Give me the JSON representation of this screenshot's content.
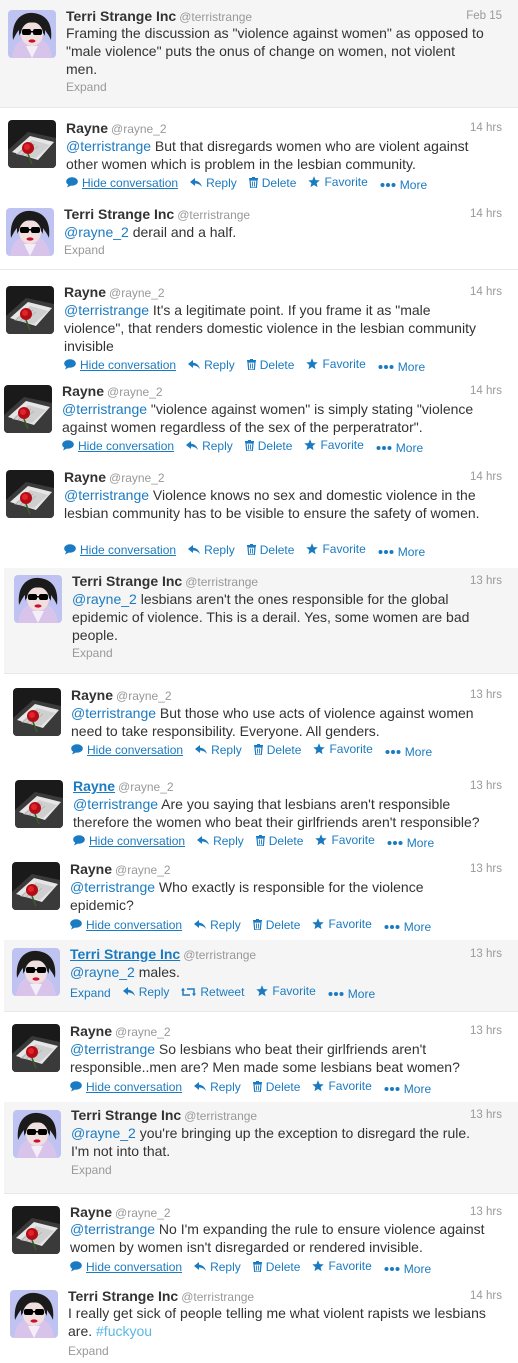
{
  "icons": {
    "reply": "reply-arrow-icon",
    "delete": "trash-icon",
    "favorite": "star-icon",
    "more": "dots-icon",
    "retweet": "retweet-icon",
    "hide": "speech-bubble-icon"
  },
  "colors": {
    "link": "#1b7bc2",
    "hashtag": "#5bb8e6",
    "meta": "#999999",
    "text": "#333333",
    "highlight_bg": "#f5f5f5"
  },
  "labels": {
    "hide_conversation": "Hide conversation",
    "reply": "Reply",
    "delete": "Delete",
    "favorite": "Favorite",
    "more": "More",
    "retweet": "Retweet",
    "expand": "Expand"
  },
  "tweets": [
    {
      "author": "Terri Strange Inc",
      "handle": "@terristrange",
      "time": "Feb 15",
      "avatar": "terri",
      "segments": [
        {
          "t": "Framing the discussion as \"violence against women\" as opposed to \"male violence\" puts the onus of change on women, not violent men."
        }
      ],
      "footer": "expand"
    },
    {
      "author": "Rayne",
      "handle": "@rayne_2",
      "time": "14 hrs",
      "avatar": "rayne",
      "segments": [
        {
          "t": "@terristrange",
          "c": "mention"
        },
        {
          "t": " But that disregards women who are violent against other women which is problem in the lesbian community."
        }
      ],
      "footer": "own"
    },
    {
      "author": "Terri Strange Inc",
      "handle": "@terristrange",
      "time": "14 hrs",
      "avatar": "terri",
      "segments": [
        {
          "t": "@rayne_2",
          "c": "mention"
        },
        {
          "t": " derail and a half."
        }
      ],
      "footer": "expand"
    },
    {
      "author": "Rayne",
      "handle": "@rayne_2",
      "time": "14 hrs",
      "avatar": "rayne",
      "segments": [
        {
          "t": "@terristrange",
          "c": "mention"
        },
        {
          "t": " It's a legitimate point. If you frame it as \"male violence\", that renders domestic violence in the lesbian community invisible"
        }
      ],
      "footer": "own"
    },
    {
      "author": "Rayne",
      "handle": "@rayne_2",
      "time": "14 hrs",
      "avatar": "rayne",
      "segments": [
        {
          "t": "@terristrange",
          "c": "mention"
        },
        {
          "t": " \"violence against women\" is simply stating \"violence against women regardless of the sex of the perperatrator\"."
        }
      ],
      "footer": "own"
    },
    {
      "author": "Rayne",
      "handle": "@rayne_2",
      "time": "14 hrs",
      "avatar": "rayne",
      "segments": [
        {
          "t": "@terristrange",
          "c": "mention"
        },
        {
          "t": " Violence knows no sex and domestic violence in the lesbian community has to be visible to ensure the safety of women."
        }
      ],
      "footer": "own"
    },
    {
      "author": "Terri Strange Inc",
      "handle": "@terristrange",
      "time": "13 hrs",
      "avatar": "terri",
      "segments": [
        {
          "t": "@rayne_2",
          "c": "mention"
        },
        {
          "t": " lesbians aren't the ones responsible for the global epidemic of violence. This is a derail. Yes, some women are bad people."
        }
      ],
      "footer": "expand"
    },
    {
      "author": "Rayne",
      "handle": "@rayne_2",
      "time": "13 hrs",
      "avatar": "rayne",
      "segments": [
        {
          "t": "@terristrange",
          "c": "mention"
        },
        {
          "t": " But those who use acts of violence against women need to take responsibility. Everyone. All genders."
        }
      ],
      "footer": "own"
    },
    {
      "author": "Rayne",
      "handle": "@rayne_2",
      "time": "13 hrs",
      "avatar": "rayne",
      "segments": [
        {
          "t": "@terristrange",
          "c": "mention"
        },
        {
          "t": " Are you saying that lesbians aren't responsible therefore the women who beat their girlfriends aren't responsible?"
        }
      ],
      "footer": "own"
    },
    {
      "author": "Rayne",
      "handle": "@rayne_2",
      "time": "13 hrs",
      "avatar": "rayne",
      "segments": [
        {
          "t": "@terristrange",
          "c": "mention"
        },
        {
          "t": " Who exactly is responsible for the violence epidemic?"
        }
      ],
      "footer": "own"
    },
    {
      "author": "Terri Strange Inc",
      "handle": "@terristrange",
      "time": "13 hrs",
      "avatar": "terri",
      "segments": [
        {
          "t": "@rayne_2",
          "c": "mention"
        },
        {
          "t": " males."
        }
      ],
      "footer": "other"
    },
    {
      "author": "Rayne",
      "handle": "@rayne_2",
      "time": "13 hrs",
      "avatar": "rayne",
      "segments": [
        {
          "t": "@terristrange",
          "c": "mention"
        },
        {
          "t": " So lesbians who beat their girlfriends aren't responsible..men are? Men made some lesbians beat women?"
        }
      ],
      "footer": "own"
    },
    {
      "author": "Terri Strange Inc",
      "handle": "@terristrange",
      "time": "13 hrs",
      "avatar": "terri",
      "segments": [
        {
          "t": "@rayne_2",
          "c": "mention"
        },
        {
          "t": " you're bringing up the exception to disregard the rule. I'm not into that."
        }
      ],
      "footer": "expand"
    },
    {
      "author": "Rayne",
      "handle": "@rayne_2",
      "time": "13 hrs",
      "avatar": "rayne",
      "segments": [
        {
          "t": "@terristrange",
          "c": "mention"
        },
        {
          "t": " No I'm expanding the rule to ensure violence against women by women isn't disregarded or rendered invisible."
        }
      ],
      "footer": "own"
    },
    {
      "author": "Terri Strange Inc",
      "handle": "@terristrange",
      "time": "14 hrs",
      "avatar": "terri",
      "segments": [
        {
          "t": "I really get sick of people telling me what violent rapists we lesbians are. "
        },
        {
          "t": "#fuckyou",
          "c": "hashtag"
        }
      ],
      "footer": "expand"
    }
  ]
}
